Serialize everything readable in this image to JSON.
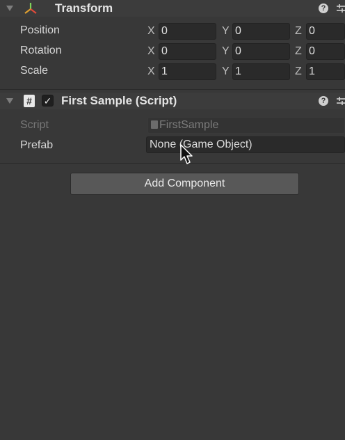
{
  "transform": {
    "title": "Transform",
    "icons": [
      "axes-icon",
      "help-icon",
      "preset-icon"
    ],
    "rows": [
      {
        "label": "Position",
        "x": "0",
        "y": "0",
        "z": "0"
      },
      {
        "label": "Rotation",
        "x": "0",
        "y": "0",
        "z": "0"
      },
      {
        "label": "Scale",
        "x": "1",
        "y": "1",
        "z": "1"
      }
    ],
    "axes": {
      "x": "X",
      "y": "Y",
      "z": "Z"
    }
  },
  "script_component": {
    "title": "First Sample (Script)",
    "enabled": true,
    "icon": "hash-icon",
    "script_label": "Script",
    "script_value": "FirstSample",
    "prefab_label": "Prefab",
    "prefab_value": "None (Game Object)"
  },
  "add_component_label": "Add Component",
  "colors": {
    "background": "#383838",
    "field": "#2a2a2a",
    "button": "#585858"
  }
}
